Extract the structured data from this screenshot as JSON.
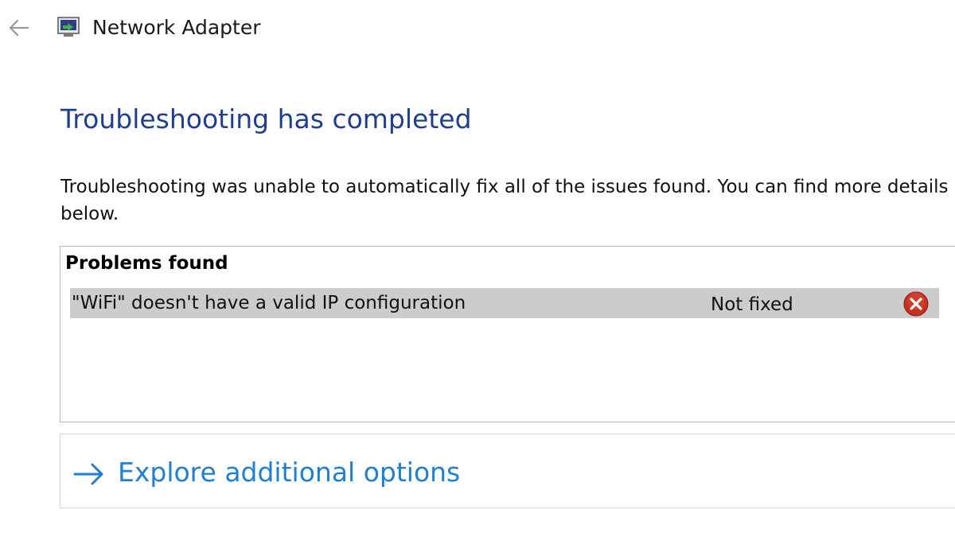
{
  "window": {
    "title": "Network Adapter",
    "back_icon": "back-arrow-icon",
    "app_icon": "network-adapter-icon"
  },
  "main": {
    "heading": "Troubleshooting has completed",
    "description": "Troubleshooting was unable to automatically fix all of the issues found. You can find more details below.",
    "problems": {
      "header": "Problems found",
      "items": [
        {
          "text": "\"WiFi\" doesn't have a valid IP configuration",
          "status": "Not fixed",
          "status_icon": "error-x-icon"
        }
      ]
    },
    "explore": {
      "label": "Explore additional options",
      "icon": "arrow-right-icon"
    }
  },
  "colors": {
    "heading": "#1e3e8f",
    "link": "#1f7fd1",
    "row_highlight": "#cccccc",
    "error": "#c6301f"
  }
}
